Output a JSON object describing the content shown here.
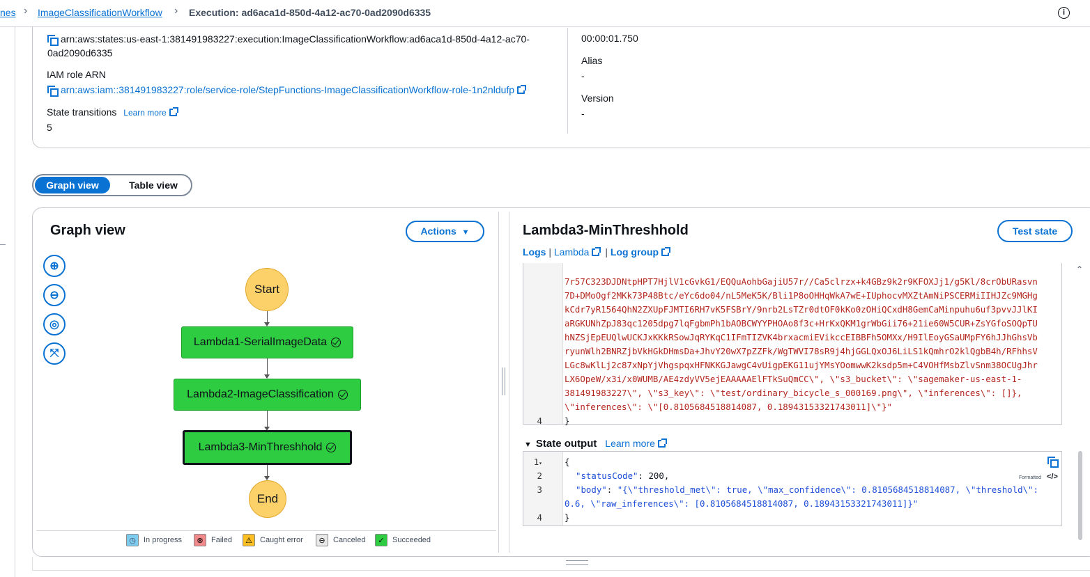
{
  "breadcrumb": {
    "part1": "nes",
    "part2": "ImageClassificationWorkflow",
    "part3": "Execution: ad6aca1d-850d-4a12-ac70-0ad2090d6335"
  },
  "details": {
    "execution_arn_line1": "arn:aws:states:us-east-1:381491983227:execution:ImageClassificationWorkflow:ad6aca1d-850d-4a12-ac70-",
    "execution_arn_line2": "0ad2090d6335",
    "iam_label": "IAM role ARN",
    "iam_arn": "arn:aws:iam::381491983227:role/service-role/StepFunctions-ImageClassificationWorkflow-role-1n2nldufp",
    "transitions_label": "State transitions",
    "learn_more": "Learn more",
    "transitions_value": "5",
    "duration": "00:00:01.750",
    "alias_label": "Alias",
    "alias_value": "-",
    "version_label": "Version",
    "version_value": "-"
  },
  "view_toggle": {
    "graph": "Graph view",
    "table": "Table view"
  },
  "graph": {
    "title": "Graph view",
    "actions": "Actions",
    "nodes": {
      "start": "Start",
      "lambda1": "Lambda1-SerialImageData",
      "lambda2": "Lambda2-ImageClassification",
      "lambda3": "Lambda3-MinThreshhold",
      "end": "End"
    },
    "legend": {
      "in_progress": "In progress",
      "failed": "Failed",
      "caught": "Caught error",
      "canceled": "Canceled",
      "succeeded": "Succeeded"
    }
  },
  "detail": {
    "title": "Lambda3-MinThreshhold",
    "test_state": "Test state",
    "logs": "Logs",
    "sep": "|",
    "lambda": "Lambda",
    "log_group": "Log group",
    "input_lines": [
      "7r57C323DJDNtpHPT7HjlV1cGvkG1/EQQuAohbGajiU57r//Ca5clrzx+k4GBz9k2r9KFOXJj1/g5Kl/8crObURasvn",
      "7D+DMoOgf2MKk73P48Btc/eYc6do04/nL5MeK5K/Bli1P8oOHHqWkA7wE+IUphocvMXZtAmNiPSCERMiIIHJZc9MGHg",
      "kCdr7yR1564QhN2ZXUpFJMTI6RH7vK5FSBrY/9nrb2LsTZr0dtOF0kKo0zOHiQCxdH8GemCaMinpuhu6uf3pvvJJlKI",
      "aRGKUNhZpJ83qc1205dpg7lqFgbmPh1bAOBCWYYPHOAo8f3c+HrKxQKM1grWbGii76+21ie60W5CUR+ZsYGfoSOQpTU",
      "hNZSjEpEUQlwUCKJxKKkRSowJqRYKqC1IFmTIZVK4brxacmiEVikccEIBBFh5OMXx/H9IlEoyGSaUMpFY6hJJhGhsVb",
      "ryunWlh2BNRZjbVkHGkDHmsDa+JhvY20wX7pZZFk/WgTWVI78sR9j4hjGGLQxOJ6LiLS1kQmhrO2klQgbB4h/RFhhsV",
      "LGc8wKlLj2c87xNpYjVhgspqxHFNKKGJawgC4vUigpEKG11ujYMsYOomwwK2ksdp5m+C4VOHfMsbZlvSnm38OCUgJhr",
      "LX6OpeW/x3i/x0WUMB/AE4zdyVV5ejEAAAAAElFTkSuQmCC\\\", \\\"s3_bucket\\\": \\\"sagemaker-us-east-1-",
      "381491983227\\\", \\\"s3_key\\\": \\\"test/ordinary_bicycle_s_000169.png\\\", \\\"inferences\\\": []},",
      "\\\"inferences\\\": \\\"[0.8105684518814087, 0.18943153321743011]\\\"}\""
    ],
    "input_end_num": "4",
    "input_end": "}",
    "output_label": "State output",
    "output_learn_more": "Learn more",
    "formatted": "Formatted",
    "output": {
      "n1": "1",
      "l1": "{",
      "n2": "2",
      "l2_key": "\"statusCode\"",
      "l2_val": "200",
      "n3": "3",
      "l3_key": "\"body\"",
      "l3_val_a": "\"{\\\"threshold_met\\\": true, \\\"max_confidence\\\": 0.8105684518814087, \\\"threshold\\\":",
      "l3_val_b": "0.6, \\\"raw_inferences\\\": [0.8105684518814087, 0.18943153321743011]}\"",
      "n4": "4",
      "l4": "}"
    }
  }
}
